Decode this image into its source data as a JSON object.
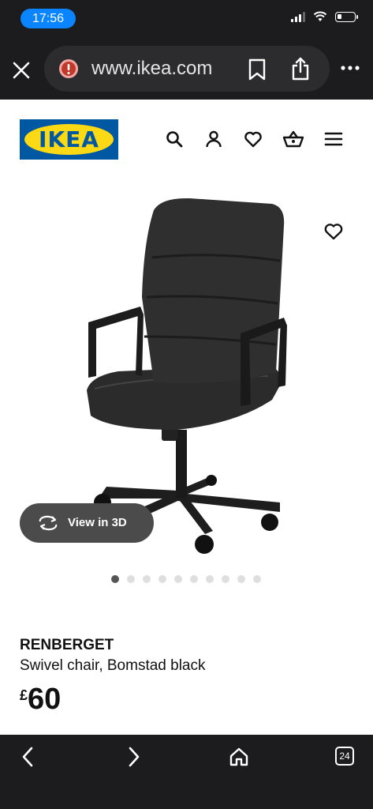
{
  "status": {
    "time": "17:56",
    "battery_level": 0.25
  },
  "browser": {
    "url": "www.ikea.com",
    "tab_count": "24"
  },
  "header": {
    "logo_text": "IKEA",
    "brand_colors": {
      "blue": "#0058a3",
      "yellow": "#fbd914"
    },
    "icons": [
      "search-icon",
      "account-icon",
      "wishlist-icon",
      "basket-icon",
      "menu-icon"
    ]
  },
  "product": {
    "view_3d_label": "View in 3D",
    "image_count": 10,
    "active_image_index": 0,
    "name": "RENBERGET",
    "description": "Swivel chair, Bomstad black",
    "currency": "£",
    "price": "60"
  }
}
